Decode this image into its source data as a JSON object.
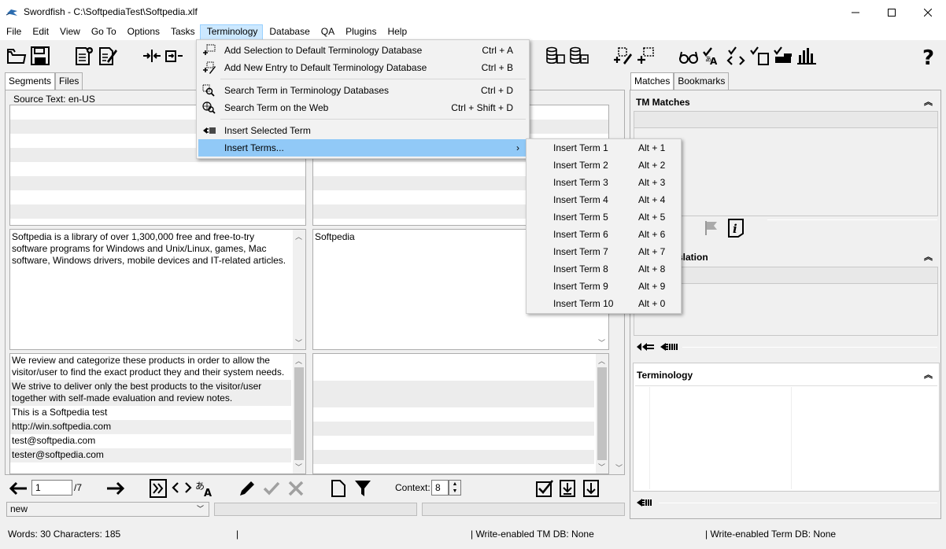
{
  "window": {
    "title": "Swordfish - C:\\SoftpediaTest\\Softpedia.xlf",
    "minimize_icon": "minimize-icon",
    "maximize_icon": "maximize-icon",
    "close_icon": "close-icon"
  },
  "menubar": {
    "items": [
      "File",
      "Edit",
      "View",
      "Go To",
      "Options",
      "Tasks",
      "Terminology",
      "Database",
      "QA",
      "Plugins",
      "Help"
    ],
    "active": "Terminology"
  },
  "left_tabs": [
    "Segments",
    "Files"
  ],
  "right_tabs": [
    "Matches",
    "Bookmarks"
  ],
  "editor": {
    "source_label": "Source Text: en-US",
    "segment_source": "Softpedia is a library of over 1,300,000 free and free-to-try software programs for Windows and Unix/Linux, games, Mac software, Windows drivers, mobile devices and IT-related articles.",
    "segment_target": "Softpedia",
    "following_lines": [
      "We review and categorize these products in order to allow the visitor/user to find the exact product they and their system needs.",
      "We strive to deliver only the best products to the visitor/user together with self-made evaluation and review notes.",
      "This is a Softpedia test",
      "http://win.softpedia.com",
      "test@softpedia.com",
      "tester@softpedia.com"
    ]
  },
  "navigation": {
    "current_segment": "1",
    "total": "/7",
    "context_label": "Context:",
    "context_value": "8",
    "status_value": "new"
  },
  "right_panel": {
    "tm_matches_title": "TM Matches",
    "translation_title_partial": "slation",
    "terminology_title": "Terminology"
  },
  "statusbar": {
    "counts": "Words: 30 Characters: 185",
    "sep1": "|",
    "tm_db": "| Write-enabled TM DB: None",
    "term_db": "| Write-enabled Term DB: None"
  },
  "terminology_menu": {
    "items": [
      {
        "label": "Add Selection to Default Terminology Database",
        "shortcut": "Ctrl + A",
        "icon": "add-selection-icon"
      },
      {
        "label": "Add New Entry to Default Terminology Database",
        "shortcut": "Ctrl + B",
        "icon": "add-entry-icon"
      },
      {
        "label": "Search Term in Terminology Databases",
        "shortcut": "Ctrl + D",
        "icon": "search-term-icon"
      },
      {
        "label": "Search Term on the Web",
        "shortcut": "Ctrl + Shift + D",
        "icon": "search-web-icon"
      },
      {
        "label": "Insert Selected Term",
        "shortcut": "",
        "icon": "insert-term-icon"
      },
      {
        "label": "Insert Terms...",
        "shortcut": "›",
        "icon": ""
      }
    ]
  },
  "insert_terms_submenu": {
    "items": [
      {
        "label": "Insert Term 1",
        "shortcut": "Alt + 1"
      },
      {
        "label": "Insert Term 2",
        "shortcut": "Alt + 2"
      },
      {
        "label": "Insert Term 3",
        "shortcut": "Alt + 3"
      },
      {
        "label": "Insert Term 4",
        "shortcut": "Alt + 4"
      },
      {
        "label": "Insert Term 5",
        "shortcut": "Alt + 5"
      },
      {
        "label": "Insert Term 6",
        "shortcut": "Alt + 6"
      },
      {
        "label": "Insert Term 7",
        "shortcut": "Alt + 7"
      },
      {
        "label": "Insert Term 8",
        "shortcut": "Alt + 8"
      },
      {
        "label": "Insert Term 9",
        "shortcut": "Alt + 9"
      },
      {
        "label": "Insert Term 10",
        "shortcut": "Alt + 0"
      }
    ]
  },
  "colors": {
    "menu_highlight": "#91c9f7",
    "menubar_active": "#cce8ff"
  }
}
